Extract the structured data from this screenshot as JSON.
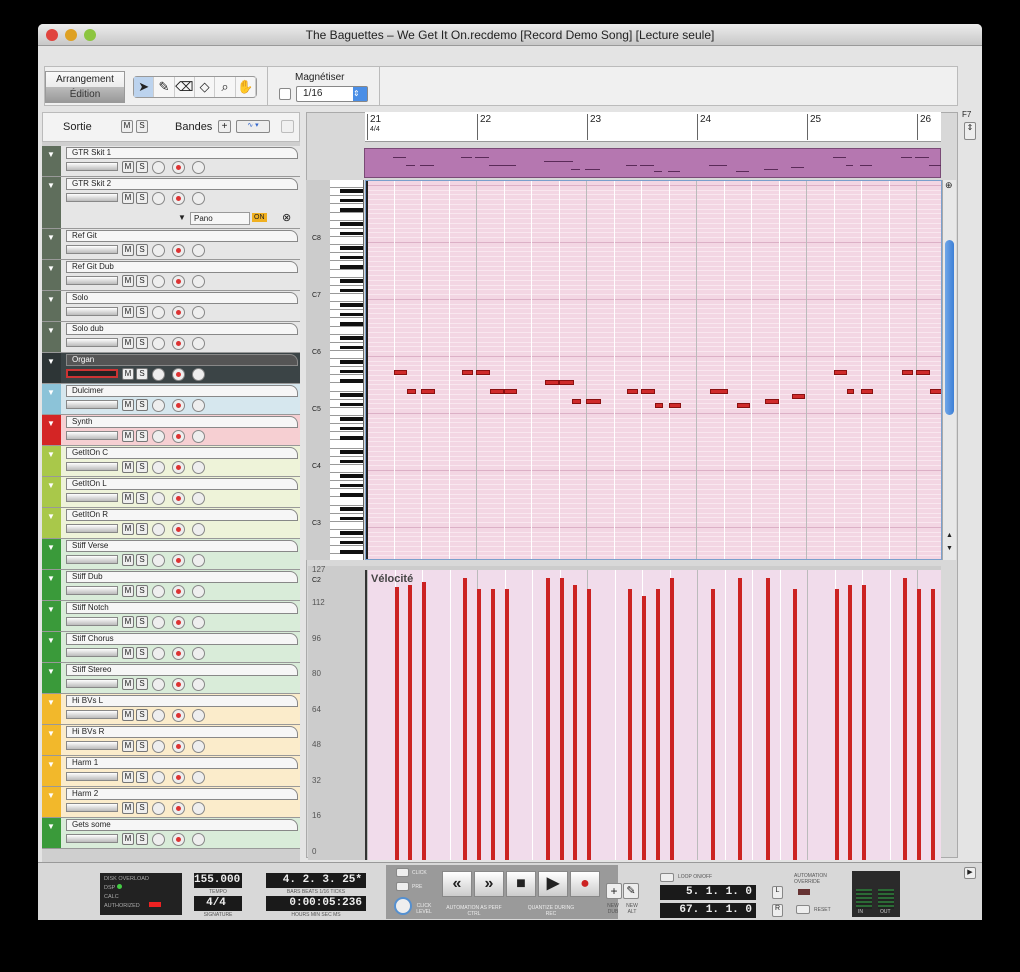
{
  "window": {
    "title": "The Baguettes – We Get It On.recdemo [Record Demo Song] [Lecture seule]"
  },
  "toolbar": {
    "mode_arrangement": "Arrangement",
    "mode_edition": "Édition",
    "snap_label": "Magnétiser",
    "snap_value": "1/16",
    "f7": "F7"
  },
  "track_header": {
    "output": "Sortie",
    "m": "M",
    "s": "S",
    "lanes": "Bandes",
    "add": "+"
  },
  "tracks": [
    {
      "name": "GTR Skit 1",
      "color": "#5f6e5c",
      "bg": "#e6e6e6"
    },
    {
      "name": "GTR Skit 2",
      "color": "#5f6e5c",
      "bg": "#e6e6e6",
      "lane": "Pano",
      "lane_state": "ON"
    },
    {
      "name": "Ref Git",
      "color": "#5f6e5c",
      "bg": "#e6e6e6"
    },
    {
      "name": "Ref Git Dub",
      "color": "#5f6e5c",
      "bg": "#e6e6e6"
    },
    {
      "name": "Solo",
      "color": "#5f6e5c",
      "bg": "#e6e6e6"
    },
    {
      "name": "Solo dub",
      "color": "#5f6e5c",
      "bg": "#e6e6e6"
    },
    {
      "name": "Organ",
      "color": "#2d3536",
      "bg": "#3b4446",
      "selected": true
    },
    {
      "name": "Dulcimer",
      "color": "#8cc3d8",
      "bg": "#d6e7ee"
    },
    {
      "name": "Synth",
      "color": "#d42525",
      "bg": "#f6cfd2"
    },
    {
      "name": "GetItOn C",
      "color": "#a9c84a",
      "bg": "#eef3d9"
    },
    {
      "name": "GetItOn L",
      "color": "#a9c84a",
      "bg": "#eef3d9"
    },
    {
      "name": "GetItOn R",
      "color": "#a9c84a",
      "bg": "#eef3d9"
    },
    {
      "name": "Stiff Verse",
      "color": "#3a9a3a",
      "bg": "#d9ecd9"
    },
    {
      "name": "Stiff Dub",
      "color": "#3a9a3a",
      "bg": "#d9ecd9"
    },
    {
      "name": "Stiff Notch",
      "color": "#3a9a3a",
      "bg": "#d9ecd9"
    },
    {
      "name": "Stiff Chorus",
      "color": "#3a9a3a",
      "bg": "#d9ecd9"
    },
    {
      "name": "Stiff Stereo",
      "color": "#3a9a3a",
      "bg": "#d9ecd9"
    },
    {
      "name": "Hi BVs L",
      "color": "#f2b82b",
      "bg": "#fbeccb"
    },
    {
      "name": "Hi BVs R",
      "color": "#f2b82b",
      "bg": "#fbeccb"
    },
    {
      "name": "Harm 1",
      "color": "#f2b82b",
      "bg": "#fbeccb"
    },
    {
      "name": "Harm 2",
      "color": "#f2b82b",
      "bg": "#fbeccb"
    },
    {
      "name": "Gets some",
      "color": "#3a9a3a",
      "bg": "#d9ecd9"
    }
  ],
  "ruler": {
    "bars": [
      "21",
      "22",
      "23",
      "24",
      "25",
      "26"
    ],
    "signature": "4/4"
  },
  "keyboard": {
    "octaves": [
      "C8",
      "C7",
      "C6",
      "C5",
      "C4",
      "C3",
      "C2"
    ]
  },
  "notes": [
    {
      "start": 1.0,
      "len": 0.5,
      "pitch": 80,
      "vel": 123
    },
    {
      "start": 1.5,
      "len": 0.3,
      "pitch": 76,
      "vel": 124
    },
    {
      "start": 2.0,
      "len": 0.5,
      "pitch": 76,
      "vel": 125
    },
    {
      "start": 3.5,
      "len": 0.4,
      "pitch": 80,
      "vel": 127
    },
    {
      "start": 4.0,
      "len": 0.5,
      "pitch": 80,
      "vel": 122
    },
    {
      "start": 4.5,
      "len": 0.5,
      "pitch": 76,
      "vel": 122
    },
    {
      "start": 5.0,
      "len": 0.5,
      "pitch": 76,
      "vel": 122
    },
    {
      "start": 6.5,
      "len": 0.5,
      "pitch": 78,
      "vel": 127
    },
    {
      "start": 7.0,
      "len": 0.55,
      "pitch": 78,
      "vel": 127
    },
    {
      "start": 7.5,
      "len": 0.3,
      "pitch": 74,
      "vel": 124
    },
    {
      "start": 8.0,
      "len": 0.55,
      "pitch": 74,
      "vel": 122
    },
    {
      "start": 9.5,
      "len": 0.4,
      "pitch": 76,
      "vel": 122
    },
    {
      "start": 10.0,
      "len": 0.5,
      "pitch": 76,
      "vel": 119
    },
    {
      "start": 10.5,
      "len": 0.3,
      "pitch": 73,
      "vel": 122
    },
    {
      "start": 11.0,
      "len": 0.45,
      "pitch": 73,
      "vel": 127
    },
    {
      "start": 12.5,
      "len": 0.65,
      "pitch": 76,
      "vel": 122
    },
    {
      "start": 13.5,
      "len": 0.45,
      "pitch": 73,
      "vel": 127
    },
    {
      "start": 14.5,
      "len": 0.5,
      "pitch": 74,
      "vel": 127
    },
    {
      "start": 15.5,
      "len": 0.45,
      "pitch": 75,
      "vel": 122
    },
    {
      "start": 17.0,
      "len": 0.5,
      "pitch": 80,
      "vel": 122
    },
    {
      "start": 17.5,
      "len": 0.25,
      "pitch": 76,
      "vel": 124
    },
    {
      "start": 18.0,
      "len": 0.45,
      "pitch": 76,
      "vel": 124
    },
    {
      "start": 19.5,
      "len": 0.4,
      "pitch": 80,
      "vel": 127
    },
    {
      "start": 20.0,
      "len": 0.5,
      "pitch": 80,
      "vel": 122
    },
    {
      "start": 20.5,
      "len": 0.45,
      "pitch": 76,
      "vel": 122
    }
  ],
  "velocity": {
    "label": "Vélocité",
    "ticks": [
      "127",
      "112",
      "96",
      "80",
      "64",
      "48",
      "32",
      "16",
      "0"
    ]
  },
  "transport": {
    "disk_overload": "DISK OVERLOAD",
    "dsp": "DSP",
    "calc": "CALC",
    "authorized": "AUTHORIZED",
    "tempo": "155.000",
    "tempo_label": "TEMPO",
    "signature": "4/4",
    "signature_label": "SIGNATURE",
    "position": "4. 2. 3. 25*",
    "position_label": "BARS BEATS 1/16 TICKS",
    "time": "0:00:05:236",
    "time_label": "HOURS MIN SEC MS",
    "click": "CLICK",
    "pre": "PRE",
    "click_level": "CLICK LEVEL",
    "automation_as_perf": "AUTOMATION AS PERF CTRL",
    "quantize": "QUANTIZE DURING REC",
    "new_dub": "NEW DUB",
    "new_alt": "NEW ALT",
    "loop": "LOOP ON/OFF",
    "loop_left": "5. 1. 1.   0",
    "loop_right": "67. 1. 1.   0",
    "l": "L",
    "r": "R",
    "automation_override": "AUTOMATION OVERRIDE",
    "reset": "RESET",
    "in": "IN",
    "out": "OUT"
  }
}
